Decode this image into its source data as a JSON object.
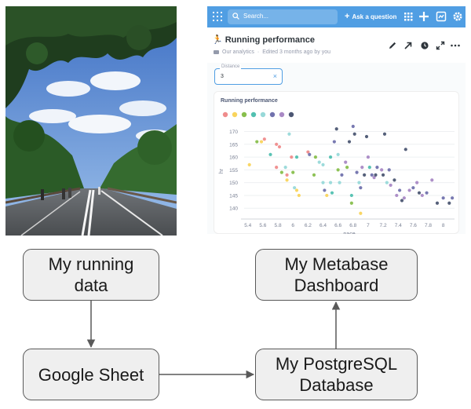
{
  "metabase": {
    "search_placeholder": "Search...",
    "ask_label": "Ask a question",
    "title": "Running performance",
    "title_emoji": "🏃",
    "collection": "Our analytics",
    "edited": "Edited 3 months ago by you",
    "filter": {
      "label": "Distance",
      "value": "3",
      "clear": "×"
    },
    "brand_color": "#509ee3"
  },
  "chart_data": {
    "type": "scatter",
    "title": "Running performance",
    "xlabel": "pace",
    "ylabel": "hr",
    "xlim": [
      5.35,
      8.15
    ],
    "ylim": [
      137,
      172
    ],
    "xticks": [
      5.4,
      5.6,
      5.8,
      6,
      6.2,
      6.4,
      6.6,
      6.8,
      7,
      7.2,
      7.4,
      7.6,
      7.8,
      8
    ],
    "yticks": [
      140,
      145,
      150,
      155,
      160,
      165,
      170
    ],
    "legend_colors": [
      "#ef8c8c",
      "#f9d45c",
      "#88bf4d",
      "#51c0b0",
      "#98d9d9",
      "#7172ad",
      "#a989c5",
      "#4c5773"
    ],
    "points": [
      [
        5.42,
        157,
        "#f9d45c"
      ],
      [
        5.52,
        166,
        "#88bf4d"
      ],
      [
        5.58,
        166,
        "#f9d45c"
      ],
      [
        5.62,
        167,
        "#ef8c8c"
      ],
      [
        5.7,
        161,
        "#51c0b0"
      ],
      [
        5.78,
        165,
        "#ef8c8c"
      ],
      [
        5.78,
        156,
        "#ef8c8c"
      ],
      [
        5.82,
        164,
        "#ef8c8c"
      ],
      [
        5.85,
        154,
        "#88bf4d"
      ],
      [
        5.9,
        156,
        "#98d9d9"
      ],
      [
        5.92,
        153,
        "#ef8c8c"
      ],
      [
        5.92,
        151,
        "#f9d45c"
      ],
      [
        5.95,
        169,
        "#98d9d9"
      ],
      [
        5.98,
        160,
        "#ef8c8c"
      ],
      [
        6.0,
        154,
        "#88bf4d"
      ],
      [
        6.02,
        148,
        "#98d9d9"
      ],
      [
        6.05,
        147,
        "#f9d45c"
      ],
      [
        6.08,
        145,
        "#f9d45c"
      ],
      [
        6.05,
        160,
        "#51c0b0"
      ],
      [
        6.2,
        162,
        "#ef8c8c"
      ],
      [
        6.22,
        161,
        "#7172ad"
      ],
      [
        6.28,
        153,
        "#88bf4d"
      ],
      [
        6.3,
        160,
        "#88bf4d"
      ],
      [
        6.35,
        158,
        "#98d9d9"
      ],
      [
        6.4,
        157,
        "#98d9d9"
      ],
      [
        6.4,
        150,
        "#98d9d9"
      ],
      [
        6.42,
        147,
        "#7172ad"
      ],
      [
        6.45,
        145,
        "#f9d45c"
      ],
      [
        6.5,
        160,
        "#51c0b0"
      ],
      [
        6.5,
        150,
        "#98d9d9"
      ],
      [
        6.52,
        146,
        "#51c0b0"
      ],
      [
        6.55,
        166,
        "#7172ad"
      ],
      [
        6.58,
        171,
        "#4c5773"
      ],
      [
        6.6,
        161,
        "#98d9d9"
      ],
      [
        6.6,
        155,
        "#88bf4d"
      ],
      [
        6.62,
        150,
        "#98d9d9"
      ],
      [
        6.65,
        153,
        "#7172ad"
      ],
      [
        6.7,
        158,
        "#a989c5"
      ],
      [
        6.72,
        156,
        "#88bf4d"
      ],
      [
        6.75,
        166,
        "#4c5773"
      ],
      [
        6.78,
        145,
        "#51c0b0"
      ],
      [
        6.78,
        142,
        "#88bf4d"
      ],
      [
        6.8,
        172,
        "#7172ad"
      ],
      [
        6.82,
        169,
        "#4c5773"
      ],
      [
        6.85,
        154,
        "#7172ad"
      ],
      [
        6.88,
        150,
        "#98d9d9"
      ],
      [
        6.9,
        148,
        "#7172ad"
      ],
      [
        6.92,
        156,
        "#a989c5"
      ],
      [
        6.95,
        153,
        "#4c5773"
      ],
      [
        6.98,
        168,
        "#4c5773"
      ],
      [
        7.0,
        160,
        "#a989c5"
      ],
      [
        7.02,
        156,
        "#51c0b0"
      ],
      [
        7.05,
        153,
        "#7172ad"
      ],
      [
        7.08,
        152,
        "#a989c5"
      ],
      [
        7.1,
        153,
        "#4c5773"
      ],
      [
        7.12,
        156,
        "#7172ad"
      ],
      [
        7.18,
        155,
        "#a989c5"
      ],
      [
        7.2,
        153,
        "#4c5773"
      ],
      [
        7.22,
        169,
        "#4c5773"
      ],
      [
        7.25,
        150,
        "#98d9d9"
      ],
      [
        7.28,
        155,
        "#7172ad"
      ],
      [
        7.3,
        149,
        "#a989c5"
      ],
      [
        7.35,
        151,
        "#4c5773"
      ],
      [
        7.38,
        145,
        "#a989c5"
      ],
      [
        7.42,
        147,
        "#7172ad"
      ],
      [
        7.45,
        143,
        "#4c5773"
      ],
      [
        7.48,
        144,
        "#a989c5"
      ],
      [
        7.5,
        163,
        "#4c5773"
      ],
      [
        7.55,
        147,
        "#a989c5"
      ],
      [
        7.6,
        148,
        "#7172ad"
      ],
      [
        7.65,
        150,
        "#a989c5"
      ],
      [
        7.68,
        146,
        "#4c5773"
      ],
      [
        7.72,
        145,
        "#a989c5"
      ],
      [
        7.78,
        146,
        "#7172ad"
      ],
      [
        7.85,
        151,
        "#a989c5"
      ],
      [
        7.92,
        142,
        "#4c5773"
      ],
      [
        8.0,
        144,
        "#7172ad"
      ],
      [
        8.08,
        142,
        "#4c5773"
      ],
      [
        8.12,
        144,
        "#7172ad"
      ],
      [
        6.9,
        138,
        "#f9d45c"
      ]
    ]
  },
  "diagram": {
    "running_data": "My running\ndata",
    "google_sheet": "Google Sheet",
    "postgres": "My PostgreSQL\nDatabase",
    "metabase": "My Metabase\nDashboard"
  }
}
